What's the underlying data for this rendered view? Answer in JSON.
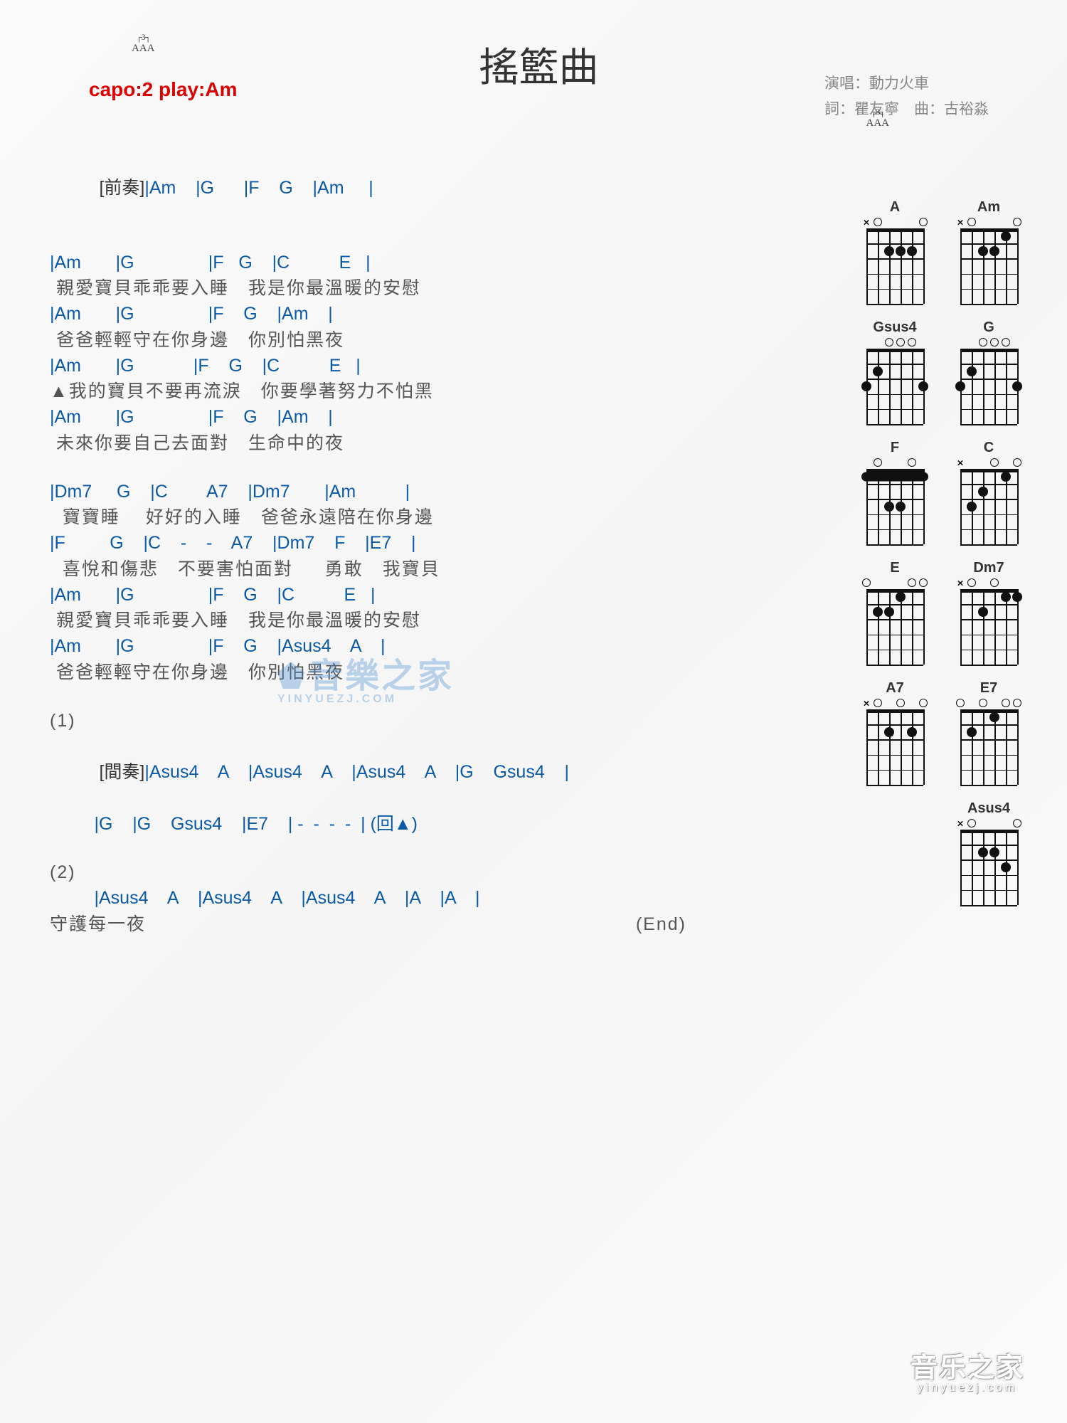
{
  "title": "搖籃曲",
  "capo": "capo:2 play:Am",
  "strum": {
    "bracket_top": "┌3┐",
    "letters": "AAA"
  },
  "credits": {
    "line1": "演唱：動力火車",
    "line2": "詞：瞿友寧　曲：古裕淼"
  },
  "watermark": {
    "main": "音樂之家",
    "sub": "YINYUEZJ.COM"
  },
  "bottom_mark": {
    "main": "音乐之家",
    "sub": "yinyuezj.com"
  },
  "lyrics": {
    "intro_label": "[前奏]",
    "intro_chords": "|Am    |G      |F    G    |Am     |",
    "v1l1c": "|Am       |G               |F   G    |C          E   |",
    "v1l1t": " 親愛寶貝乖乖要入睡　我是你最溫暖的安慰",
    "v1l2c": "|Am       |G               |F    G    |Am    |",
    "v1l2t": " 爸爸輕輕守在你身邊　你別怕黑夜",
    "v1l3c": "|Am       |G            |F    G    |C          E   |",
    "v1l3t": "▲我的寶貝不要再流淚　你要學著努力不怕黑",
    "v1l4c": "|Am       |G               |F    G    |Am    |",
    "v1l4t": " 未來你要自己去面對　生命中的夜",
    "v2l1c": "|Dm7     G    |C        A7    |Dm7       |Am          |",
    "v2l1t": "  寶寶睡　 好好的入睡　爸爸永遠陪在你身邊",
    "v2l2c": "|F         G    |C    -    -    A7    |Dm7    F    |E7    |",
    "v2l2t": "  喜悅和傷悲　不要害怕面對　  勇敢　我寶貝",
    "v2l3c": "|Am       |G               |F    G    |C          E   |",
    "v2l3t": " 親愛寶貝乖乖要入睡　我是你最溫暖的安慰",
    "v2l4c": "|Am       |G               |F    G    |Asus4    A    |",
    "v2l4t": " 爸爸輕輕守在你身邊　你別怕黑夜",
    "sec1": "(1)",
    "inter_label": "[間奏]",
    "inter1": "|Asus4    A    |Asus4    A    |Asus4    A    |G    Gsus4    |",
    "inter2": "         |G    |G    Gsus4    |E7    | -  -  -  -  | (回▲)",
    "sec2": "(2)",
    "out_c": "         |Asus4    A    |Asus4    A    |Asus4    A    |A    |A    |",
    "out_t": "守護每一夜",
    "end": "(End)"
  },
  "chords": [
    {
      "name": "A",
      "mutes": [
        1
      ],
      "opens": [
        2,
        6
      ],
      "dots": [
        [
          3,
          2
        ],
        [
          4,
          2
        ],
        [
          5,
          2
        ]
      ]
    },
    {
      "name": "Am",
      "mutes": [
        1
      ],
      "opens": [
        2,
        6
      ],
      "dots": [
        [
          3,
          2
        ],
        [
          4,
          2
        ],
        [
          5,
          1
        ]
      ]
    },
    {
      "name": "Gsus4",
      "opens": [
        4,
        5
      ],
      "dots": [
        [
          1,
          3
        ],
        [
          2,
          2
        ],
        [
          3,
          0.01
        ],
        [
          6,
          3
        ]
      ]
    },
    {
      "name": "G",
      "opens": [
        3,
        4,
        5
      ],
      "dots": [
        [
          1,
          3
        ],
        [
          2,
          2
        ],
        [
          6,
          3
        ]
      ]
    },
    {
      "name": "F",
      "barre": {
        "fret": 1,
        "from": 1,
        "to": 6
      },
      "dots": [
        [
          3,
          3
        ],
        [
          4,
          3
        ],
        [
          2,
          0.01
        ],
        [
          5,
          0.01
        ]
      ],
      "mutes": [],
      "opens": []
    },
    {
      "name": "C",
      "mutes": [
        1
      ],
      "opens": [
        4,
        6
      ],
      "dots": [
        [
          2,
          3
        ],
        [
          3,
          2
        ],
        [
          5,
          1
        ]
      ]
    },
    {
      "name": "E",
      "opens": [
        5,
        6
      ],
      "dots": [
        [
          1,
          0.01
        ],
        [
          2,
          2
        ],
        [
          3,
          2
        ],
        [
          4,
          1
        ]
      ]
    },
    {
      "name": "Dm7",
      "mutes": [
        1
      ],
      "opens": [
        2,
        4
      ],
      "dots": [
        [
          3,
          2
        ],
        [
          5,
          1
        ],
        [
          6,
          1
        ]
      ]
    },
    {
      "name": "A7",
      "mutes": [
        1
      ],
      "opens": [
        2,
        4,
        6
      ],
      "dots": [
        [
          3,
          2
        ],
        [
          5,
          2
        ]
      ]
    },
    {
      "name": "E7",
      "opens": [
        3,
        5,
        6
      ],
      "dots": [
        [
          1,
          0.01
        ],
        [
          2,
          2
        ],
        [
          4,
          1
        ]
      ]
    },
    {
      "name": "Asus4",
      "mutes": [
        1
      ],
      "opens": [
        2,
        6
      ],
      "dots": [
        [
          3,
          2
        ],
        [
          4,
          2
        ],
        [
          5,
          3
        ]
      ]
    }
  ]
}
